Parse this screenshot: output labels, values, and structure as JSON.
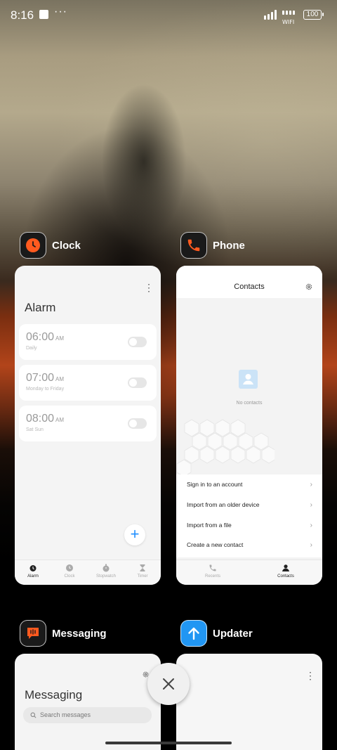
{
  "status_bar": {
    "time": "8:16",
    "wifi_label": "WIFI",
    "battery": "100"
  },
  "recents": [
    {
      "app": "Clock",
      "icon": "clock-icon",
      "accent": "#ff5a1f"
    },
    {
      "app": "Phone",
      "icon": "phone-icon",
      "accent": "#ff5a1f"
    },
    {
      "app": "Messaging",
      "icon": "message-icon",
      "accent": "#ff5a1f"
    },
    {
      "app": "Updater",
      "icon": "arrow-up-icon",
      "accent": "#2196f3"
    }
  ],
  "clock": {
    "title": "Alarm",
    "alarms": [
      {
        "time": "06:00",
        "ampm": "AM",
        "repeat": "Daily",
        "enabled": false
      },
      {
        "time": "07:00",
        "ampm": "AM",
        "repeat": "Monday to Friday",
        "enabled": false
      },
      {
        "time": "08:00",
        "ampm": "AM",
        "repeat": "Sat Sun",
        "enabled": false
      }
    ],
    "nav": [
      {
        "label": "Alarm",
        "icon": "alarm-icon",
        "active": true
      },
      {
        "label": "Clock",
        "icon": "clock-icon",
        "active": false
      },
      {
        "label": "Stopwatch",
        "icon": "stopwatch-icon",
        "active": false
      },
      {
        "label": "Timer",
        "icon": "hourglass-icon",
        "active": false
      }
    ]
  },
  "phone": {
    "title": "Contacts",
    "empty_text": "No contacts",
    "menu": [
      "Sign in to an account",
      "Import from an older device",
      "Import from a file",
      "Create a new contact"
    ],
    "nav": [
      {
        "label": "Recents",
        "icon": "phone-icon",
        "active": false
      },
      {
        "label": "Contacts",
        "icon": "person-icon",
        "active": true
      }
    ]
  },
  "messaging": {
    "title": "Messaging",
    "search_placeholder": "Search messages"
  },
  "colors": {
    "link_blue": "#1f8fff",
    "wallpaper_accent": "#b2441a"
  }
}
